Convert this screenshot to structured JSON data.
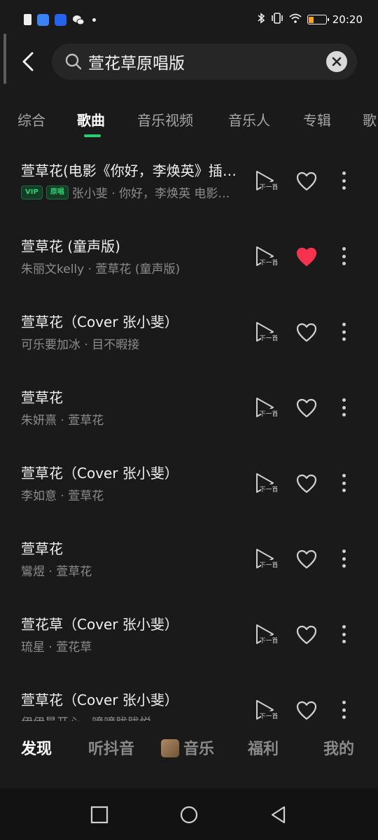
{
  "status_bar": {
    "time": "20:20",
    "battery_level": 0.3,
    "battery_color": "#f5a524",
    "left_icons": [
      "sim-icon",
      "app-notification-icon",
      "security-shield-icon",
      "wechat-icon",
      "more-dot-icon"
    ],
    "right_icons": [
      "bluetooth-icon",
      "vibrate-icon",
      "wifi-icon",
      "battery-icon"
    ]
  },
  "search": {
    "query": "萱花草原唱版"
  },
  "tabs": [
    {
      "label": "综合"
    },
    {
      "label": "歌曲"
    },
    {
      "label": "音乐视频"
    },
    {
      "label": "音乐人"
    },
    {
      "label": "专辑"
    },
    {
      "label": "歌"
    }
  ],
  "active_tab": "歌曲",
  "songs": [
    {
      "title": "萱草花(电影《你好，李焕英》插曲)",
      "badges": [
        "VIP",
        "原唱"
      ],
      "subtitle": "张小斐 · 你好，李焕英 电影原声",
      "liked": false
    },
    {
      "title": "萱草花 (童声版)",
      "badges": [],
      "subtitle": "朱丽文kelly · 萱草花 (童声版)",
      "liked": true
    },
    {
      "title": "萱草花（Cover 张小斐）",
      "badges": [],
      "subtitle": "可乐要加冰 · 目不暇接",
      "liked": false
    },
    {
      "title": "萱草花",
      "badges": [],
      "subtitle": "朱妍熹 · 萱草花",
      "liked": false
    },
    {
      "title": "萱草花（Cover 张小斐）",
      "badges": [],
      "subtitle": "李如意 · 萱草花",
      "liked": false
    },
    {
      "title": "萱草花",
      "badges": [],
      "subtitle": "鸞煜 · 萱草花",
      "liked": false
    },
    {
      "title": "萱花草（Cover 张小斐）",
      "badges": [],
      "subtitle": "琉星 · 萱花草",
      "liked": false
    },
    {
      "title": "萱草花（Cover 张小斐）",
      "badges": [],
      "subtitle": "伊伊最开心 · 曈曈胧胧悦",
      "liked": false
    }
  ],
  "next_label": "下一首",
  "colors": {
    "accent": "#2ecc71",
    "liked_heart": "#f5334f"
  },
  "bottom_nav": [
    {
      "label": "发现"
    },
    {
      "label": "听抖音"
    },
    {
      "label": "音乐"
    },
    {
      "label": "福利"
    },
    {
      "label": "我的"
    }
  ]
}
